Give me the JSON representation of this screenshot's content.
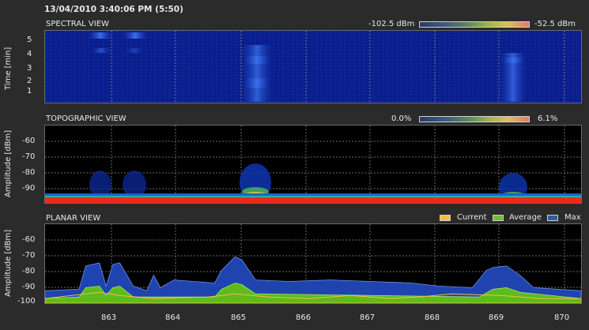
{
  "header": {
    "timestamp": "13/04/2010 3:40:06 PM (5:50)"
  },
  "spectral": {
    "title": "SPECTRAL VIEW",
    "scale_min": "-102.5 dBm",
    "scale_max": "-52.5 dBm",
    "y_label": "Time [min]",
    "y_ticks": [
      "5",
      "4",
      "3",
      "2",
      "1"
    ]
  },
  "topographic": {
    "title": "TOPOGRAPHIC VIEW",
    "scale_min": "0.0%",
    "scale_max": "6.1%",
    "y_label": "Amplitude [dBm]",
    "y_ticks": [
      "-60",
      "-70",
      "-80",
      "-90"
    ]
  },
  "planar": {
    "title": "PLANAR VIEW",
    "legend": [
      {
        "label": "Current",
        "color": "#f0c040"
      },
      {
        "label": "Average",
        "color": "#6dbf2e"
      },
      {
        "label": "Max",
        "color": "#2f5d9c"
      }
    ],
    "y_label": "Amplitude [dBm]",
    "y_ticks": [
      "-60",
      "-70",
      "-80",
      "-90",
      "-100"
    ]
  },
  "x_axis": {
    "ticks": [
      "863",
      "864",
      "865",
      "866",
      "867",
      "868",
      "869",
      "870"
    ]
  },
  "chart_data": {
    "type": "area",
    "x_range": [
      862.4,
      870.3
    ],
    "ylim": [
      -103,
      -52
    ],
    "series": [
      {
        "name": "Max",
        "x": [
          862.4,
          862.9,
          863.0,
          863.2,
          863.3,
          863.4,
          863.5,
          863.7,
          863.9,
          864.0,
          864.1,
          864.3,
          864.9,
          865.0,
          865.2,
          865.3,
          865.5,
          866.0,
          866.6,
          867.2,
          867.8,
          868.2,
          868.7,
          868.9,
          869.0,
          869.2,
          869.4,
          869.6,
          870.3
        ],
        "values": [
          -95,
          -94,
          -79,
          -77,
          -92,
          -78,
          -77,
          -92,
          -95,
          -85,
          -93,
          -88,
          -90,
          -82,
          -73,
          -75,
          -88,
          -89,
          -88,
          -89,
          -90,
          -92,
          -93,
          -82,
          -80,
          -79,
          -85,
          -93,
          -95
        ]
      },
      {
        "name": "Average",
        "x": [
          862.4,
          862.9,
          863.0,
          863.2,
          863.3,
          863.4,
          863.5,
          863.7,
          864.9,
          865.0,
          865.2,
          865.3,
          865.5,
          868.8,
          869.0,
          869.2,
          869.4,
          870.3
        ],
        "values": [
          -100,
          -99,
          -93,
          -92,
          -98,
          -93,
          -92,
          -99,
          -99,
          -94,
          -90,
          -91,
          -97,
          -99,
          -94,
          -93,
          -96,
          -100
        ]
      },
      {
        "name": "Current",
        "x": [
          862.4,
          863.0,
          863.2,
          863.5,
          864.0,
          864.8,
          865.2,
          865.7,
          866.3,
          866.9,
          867.5,
          867.9,
          868.4,
          869.1,
          869.7,
          870.3
        ],
        "values": [
          -100,
          -97,
          -96,
          -98,
          -100,
          -99,
          -97,
          -99,
          -100,
          -98,
          -100,
          -99,
          -97,
          -98,
          -100,
          -100
        ]
      }
    ]
  }
}
